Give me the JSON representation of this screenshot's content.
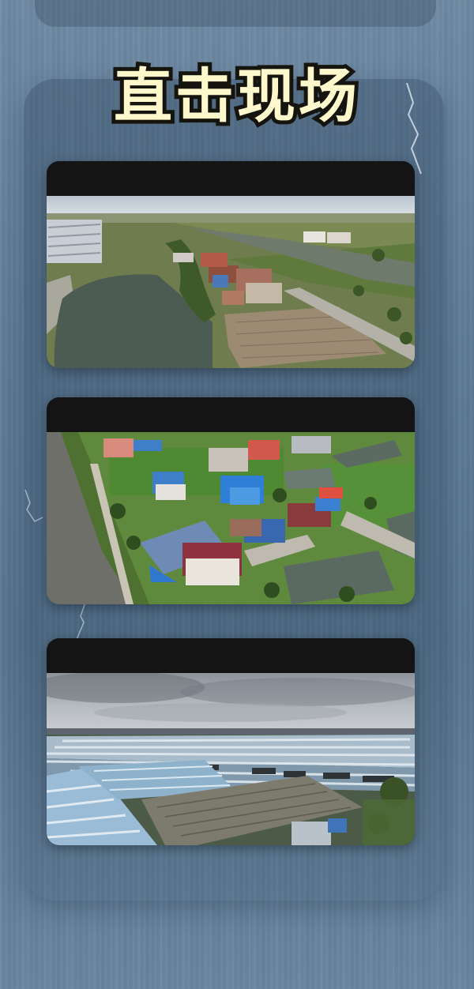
{
  "header": {
    "title": "直击现场"
  },
  "photos": [
    {
      "icon": "aerial-village-pond-image"
    },
    {
      "icon": "aerial-damaged-houses-image"
    },
    {
      "icon": "aerial-greenhouses-image"
    }
  ],
  "colors": {
    "background": "#6384a0",
    "title_fill": "#fff8cc",
    "title_stroke": "#15140f",
    "card_header": "#141414"
  }
}
